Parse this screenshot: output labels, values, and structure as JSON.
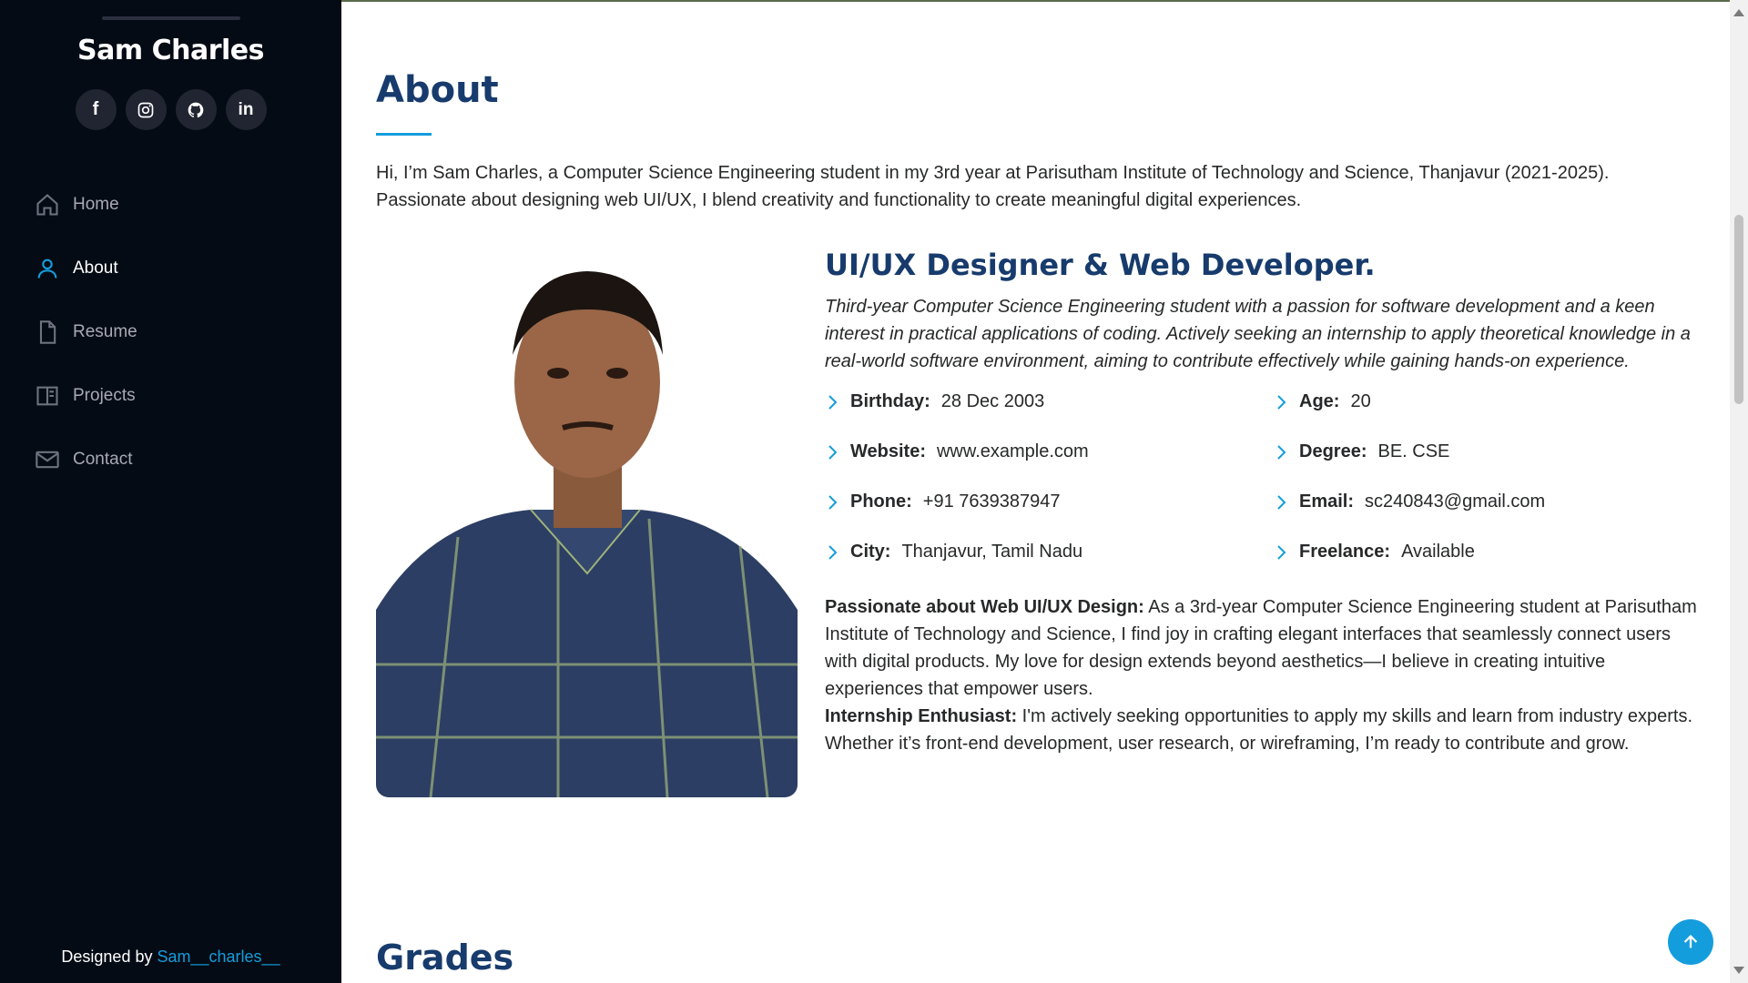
{
  "sidebar": {
    "name": "Sam Charles",
    "social": [
      {
        "icon": "facebook-icon",
        "glyph": "f"
      },
      {
        "icon": "instagram-icon"
      },
      {
        "icon": "github-icon"
      },
      {
        "icon": "linkedin-icon",
        "glyph": "in"
      }
    ],
    "nav": [
      {
        "label": "Home",
        "icon": "home-icon",
        "active": false
      },
      {
        "label": "About",
        "icon": "person-icon",
        "active": true
      },
      {
        "label": "Resume",
        "icon": "file-icon",
        "active": false
      },
      {
        "label": "Projects",
        "icon": "book-icon",
        "active": false
      },
      {
        "label": "Contact",
        "icon": "envelope-icon",
        "active": false
      }
    ],
    "credit_prefix": "Designed by ",
    "credit_link": "Sam__charles__"
  },
  "about": {
    "title": "About",
    "intro": "Hi, I’m Sam Charles, a Computer Science Engineering student in my 3rd year at Parisutham Institute of Technology and Science, Thanjavur (2021-2025). Passionate about designing web UI/UX, I blend creativity and functionality to create meaningful digital experiences.",
    "role_title": "UI/UX Designer & Web Developer.",
    "role_desc": "Third-year Computer Science Engineering student with a passion for software development and a keen interest in practical applications of coding. Actively seeking an internship to apply theoretical knowledge in a real-world software environment, aiming to contribute effectively while gaining hands-on experience.",
    "facts_left": [
      {
        "label": "Birthday:",
        "value": "28 Dec 2003"
      },
      {
        "label": "Website:",
        "value": "www.example.com"
      },
      {
        "label": "Phone:",
        "value": "+91 7639387947"
      },
      {
        "label": "City:",
        "value": "Thanjavur, Tamil Nadu"
      }
    ],
    "facts_right": [
      {
        "label": "Age:",
        "value": "20"
      },
      {
        "label": "Degree:",
        "value": "BE. CSE"
      },
      {
        "label": "Email:",
        "value": "sc240843@gmail.com"
      },
      {
        "label": "Freelance:",
        "value": "Available"
      }
    ],
    "passion_label": "Passionate about Web UI/UX Design:",
    "passion_text": " As a 3rd-year Computer Science Engineering student at Parisutham Institute of Technology and Science, I find joy in crafting elegant interfaces that seamlessly connect users with digital products. My love for design extends beyond aesthetics—I believe in creating intuitive experiences that empower users.",
    "intern_label": "Internship Enthusiast:",
    "intern_text": " I'm actively seeking opportunities to apply my skills and learn from industry experts. Whether it’s front-end development, user research, or wireframing, I’m ready to contribute and grow."
  },
  "grades": {
    "title": "Grades"
  },
  "colors": {
    "accent": "#149ddd",
    "heading": "#173b6c",
    "sidebar_bg": "#040b14"
  }
}
